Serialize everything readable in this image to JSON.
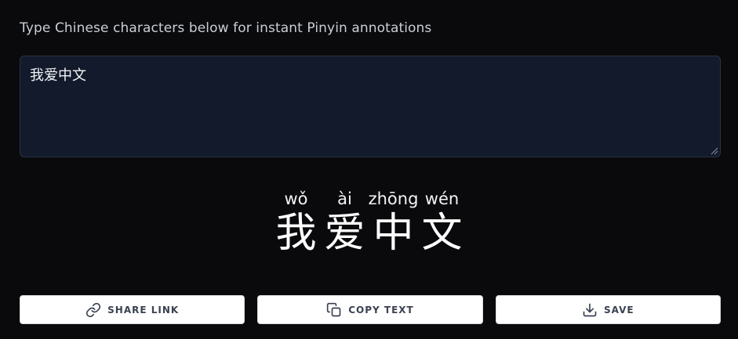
{
  "header": {
    "instructions": "Type Chinese characters below for instant Pinyin annotations"
  },
  "editor": {
    "value": "我爱中文",
    "placeholder": ""
  },
  "annotation": {
    "items": [
      {
        "pinyin": "wǒ",
        "hanzi": "我"
      },
      {
        "pinyin": "ài",
        "hanzi": "爱"
      },
      {
        "pinyin": "zhōng",
        "hanzi": "中"
      },
      {
        "pinyin": "wén",
        "hanzi": "文"
      }
    ]
  },
  "actions": {
    "share_label": "SHARE LINK",
    "copy_label": "COPY TEXT",
    "save_label": "SAVE"
  },
  "colors": {
    "background": "#0a0a0c",
    "input_bg": "#121a2b",
    "button_bg": "#ffffff",
    "button_text": "#3a4150"
  },
  "icons": {
    "share": "link-icon",
    "copy": "copy-icon",
    "save": "download-icon"
  }
}
